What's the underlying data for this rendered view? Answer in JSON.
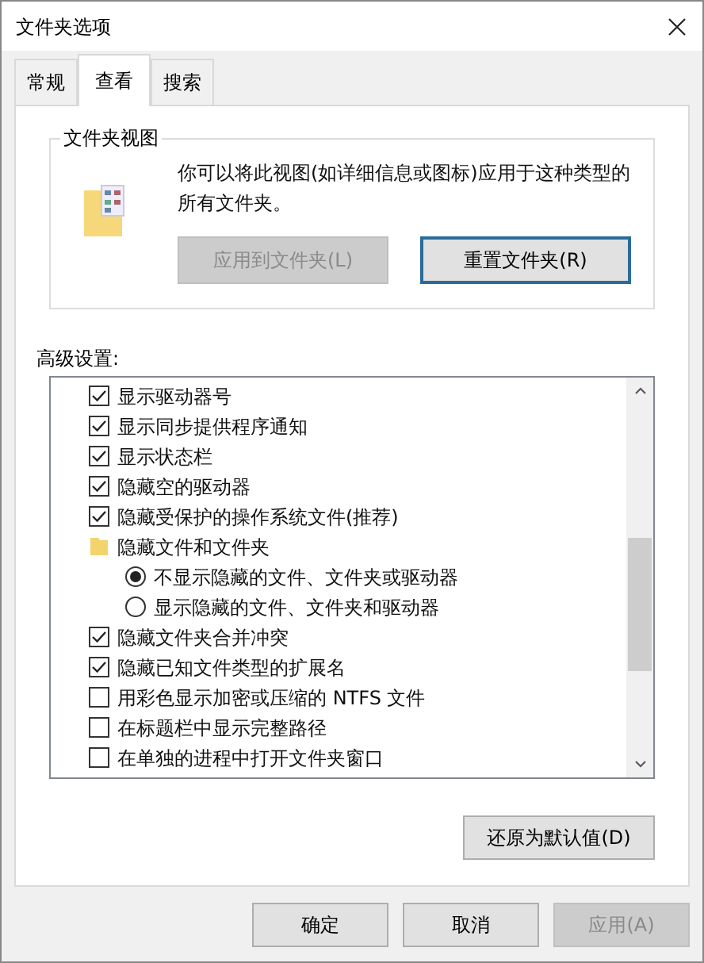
{
  "window": {
    "title": "文件夹选项"
  },
  "tabs": [
    {
      "label": "常规",
      "selected": false
    },
    {
      "label": "查看",
      "selected": true
    },
    {
      "label": "搜索",
      "selected": false
    }
  ],
  "folder_views": {
    "title": "文件夹视图",
    "description": "你可以将此视图(如详细信息或图标)应用于这种类型的所有文件夹。",
    "buttons": [
      {
        "label": "应用到文件夹(L)",
        "disabled": true,
        "focused": false
      },
      {
        "label": "重置文件夹(R)",
        "disabled": false,
        "focused": true
      }
    ]
  },
  "advanced": {
    "label": "高级设置:",
    "items": [
      {
        "kind": "checkbox",
        "label": "显示驱动器号",
        "checked": true
      },
      {
        "kind": "checkbox",
        "label": "显示同步提供程序通知",
        "checked": true
      },
      {
        "kind": "checkbox",
        "label": "显示状态栏",
        "checked": true
      },
      {
        "kind": "checkbox",
        "label": "隐藏空的驱动器",
        "checked": true
      },
      {
        "kind": "checkbox",
        "label": "隐藏受保护的操作系统文件(推荐)",
        "checked": true
      },
      {
        "kind": "folder",
        "label": "隐藏文件和文件夹",
        "children": [
          {
            "kind": "radio",
            "label": "不显示隐藏的文件、文件夹或驱动器",
            "selected": true
          },
          {
            "kind": "radio",
            "label": "显示隐藏的文件、文件夹和驱动器",
            "selected": false
          }
        ]
      },
      {
        "kind": "checkbox",
        "label": "隐藏文件夹合并冲突",
        "checked": true
      },
      {
        "kind": "checkbox",
        "label": "隐藏已知文件类型的扩展名",
        "checked": true
      },
      {
        "kind": "checkbox",
        "label": "用彩色显示加密或压缩的 NTFS 文件",
        "checked": false
      },
      {
        "kind": "checkbox",
        "label": "在标题栏中显示完整路径",
        "checked": false
      },
      {
        "kind": "checkbox",
        "label": "在单独的进程中打开文件夹窗口",
        "checked": false
      }
    ]
  },
  "restore_button": "还原为默认值(D)",
  "dialog_buttons": [
    {
      "label": "确定",
      "disabled": false
    },
    {
      "label": "取消",
      "disabled": false
    },
    {
      "label": "应用(A)",
      "disabled": true
    }
  ]
}
